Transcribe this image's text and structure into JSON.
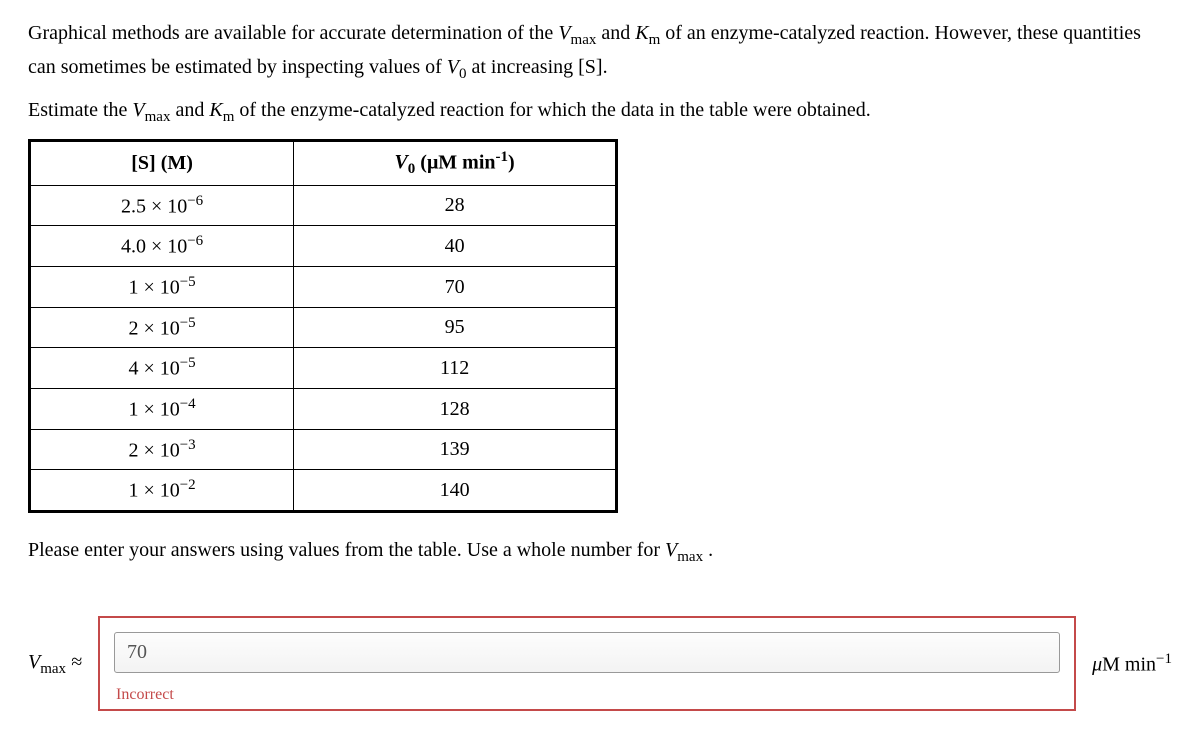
{
  "intro": {
    "p1a": "Graphical methods are available for accurate determination of the ",
    "p1b": " and ",
    "p1c": " of an enzyme-catalyzed reaction. However, these quantities can sometimes be estimated by inspecting values of ",
    "p1d": " at increasing [S].",
    "p2a": "Estimate the ",
    "p2b": " and ",
    "p2c": " of the enzyme-catalyzed reaction for which the data in the table were obtained."
  },
  "symbols": {
    "Vmax": "V",
    "Vmax_sub": "max",
    "Km": "K",
    "Km_sub": "m",
    "V0": "V",
    "V0_sub": "0"
  },
  "table": {
    "header_s": "[S] (M)",
    "header_v_prefix": "V",
    "header_v_sub": "0",
    "header_v_suffix": " (μM min",
    "header_v_exp": "-1",
    "header_v_close": ")",
    "rows": [
      {
        "s_coef": "2.5 × 10",
        "s_exp": "−6",
        "v": "28"
      },
      {
        "s_coef": "4.0 × 10",
        "s_exp": "−6",
        "v": "40"
      },
      {
        "s_coef": "1 × 10",
        "s_exp": "−5",
        "v": "70"
      },
      {
        "s_coef": "2 × 10",
        "s_exp": "−5",
        "v": "95"
      },
      {
        "s_coef": "4 × 10",
        "s_exp": "−5",
        "v": "112"
      },
      {
        "s_coef": "1 × 10",
        "s_exp": "−4",
        "v": "128"
      },
      {
        "s_coef": "2 × 10",
        "s_exp": "−3",
        "v": "139"
      },
      {
        "s_coef": "1 × 10",
        "s_exp": "−2",
        "v": "140"
      }
    ]
  },
  "instruction": {
    "a": "Please enter your answers using values from the table. Use a whole number for ",
    "b": " ."
  },
  "answer": {
    "label_prefix": "V",
    "label_sub": "max",
    "approx": " ≈",
    "value": "70",
    "incorrect": "Incorrect",
    "unit_mu": "μ",
    "unit_M": "M",
    "unit_min": " min",
    "unit_exp": "−1"
  }
}
